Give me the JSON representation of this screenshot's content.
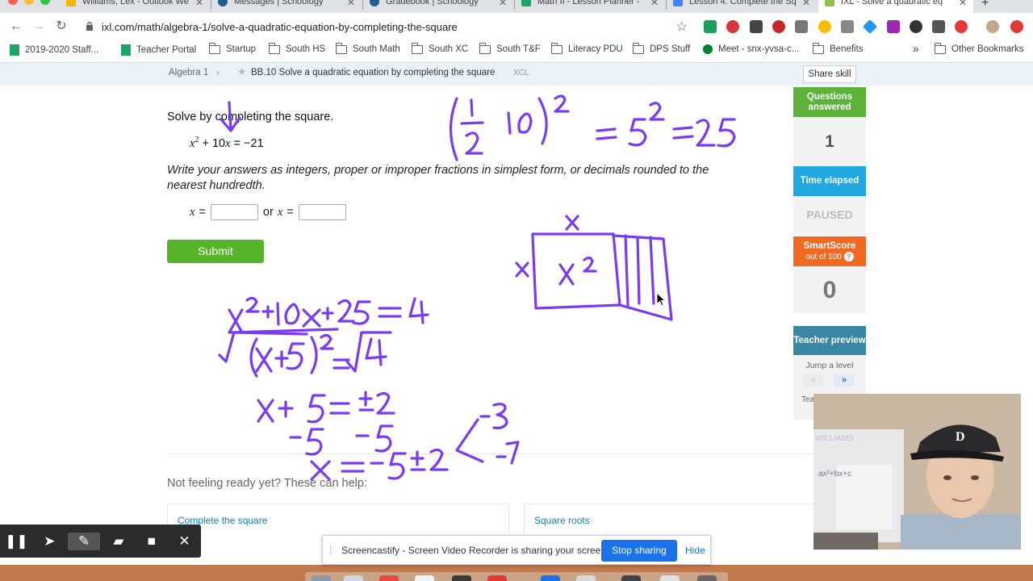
{
  "browser": {
    "tabs": [
      {
        "label": "Williams, Lex - Outlook We",
        "favicon_color": "#f2b600",
        "active": false
      },
      {
        "label": "Messages | Schoology",
        "favicon_color": "#1f5f8b",
        "active": false
      },
      {
        "label": "Gradebook | Schoology",
        "favicon_color": "#1f5f8b",
        "active": false
      },
      {
        "label": "Math II - Lesson Planner -",
        "favicon_color": "#1fa463",
        "active": false
      },
      {
        "label": "Lesson 4: Complete the Sq",
        "favicon_color": "#4285f4",
        "active": false
      },
      {
        "label": "IXL - Solve a quadratic eq",
        "favicon_color": "#8bc34a",
        "active": true
      }
    ],
    "new_tab_symbol": "+",
    "url": "ixl.com/math/algebra-1/solve-a-quadratic-equation-by-completing-the-square",
    "bookmarks": [
      {
        "label": "2019-2020 Staff...",
        "icon": "sheets-icon"
      },
      {
        "label": "Teacher Portal",
        "icon": "sheets-icon"
      },
      {
        "label": "Startup",
        "icon": "folder-icon"
      },
      {
        "label": "South HS",
        "icon": "folder-icon"
      },
      {
        "label": "South Math",
        "icon": "folder-icon"
      },
      {
        "label": "South XC",
        "icon": "folder-icon"
      },
      {
        "label": "South T&F",
        "icon": "folder-icon"
      },
      {
        "label": "Literacy PDU",
        "icon": "folder-icon"
      },
      {
        "label": "DPS Stuff",
        "icon": "folder-icon"
      },
      {
        "label": "Meet - snx-yvsa-c...",
        "icon": "meet-icon"
      },
      {
        "label": "Benefits",
        "icon": "folder-icon"
      }
    ],
    "more_bookmarks": "»",
    "other_bookmarks": "Other Bookmarks"
  },
  "ixl": {
    "breadcrumb": {
      "subject": "Algebra 1",
      "separator": "›",
      "skill": "BB.10 Solve a quadratic equation by completing the square",
      "code": "XCL"
    },
    "share_skill": "Share skill",
    "question": {
      "prompt": "Solve by completing the square.",
      "equation_x": "x",
      "equation_exp": "2",
      "equation_rest": " + 10",
      "equation_x2": "x",
      "equation_rhs": " = −21",
      "instructions": "Write your answers as integers, proper or improper fractions in simplest form, or decimals rounded to the nearest hundredth.",
      "answer_var": "x",
      "answer_eq": "=",
      "or_text": "or",
      "answer1": "",
      "answer2": ""
    },
    "submit_label": "Submit",
    "not_ready": "Not feeling ready yet? These can help:",
    "help_links": [
      "Complete the square",
      "Square roots"
    ],
    "sidebar": {
      "questions_answered_label": "Questions answered",
      "questions_answered_value": "1",
      "time_elapsed_label": "Time elapsed",
      "time_elapsed_value": "PAUSED",
      "smartscore_label": "SmartScore",
      "smartscore_sub": "out of 100",
      "smartscore_help": "?",
      "smartscore_value": "0",
      "teacher_preview_label": "Teacher preview",
      "jump_level_label": "Jump a level",
      "jump_back": "«",
      "jump_forward": "»",
      "teacher_note": "Tea no"
    },
    "colors": {
      "green": "#57b32a",
      "questions_green": "#5db33a",
      "time_blue": "#21a8e0",
      "smartscore_orange": "#f26a21",
      "preview_teal": "#3a87a5"
    }
  },
  "annotations": {
    "ink_color": "#7a3cf0",
    "top_calc": "(1/2 · 10)² = 5² = 25",
    "box_labels": [
      "x",
      "x",
      "x²"
    ],
    "steps": [
      "x²+10x+25 = 4",
      "√(x+5)² = √4",
      "x+5 = ±2",
      "-5   -5",
      "x = -5±2",
      "-3",
      "-7"
    ]
  },
  "webcam": {
    "whiteboard_text": "ax²+bx+c",
    "board_heading": "WILLIAMS"
  },
  "screencastify": {
    "tools": [
      "pause-icon",
      "cursor-icon",
      "pen-icon",
      "highlighter-icon",
      "camera-icon",
      "close-icon"
    ],
    "share_message": "Screencastify - Screen Video Recorder is sharing your screen.",
    "stop_label": "Stop sharing",
    "hide_label": "Hide"
  }
}
